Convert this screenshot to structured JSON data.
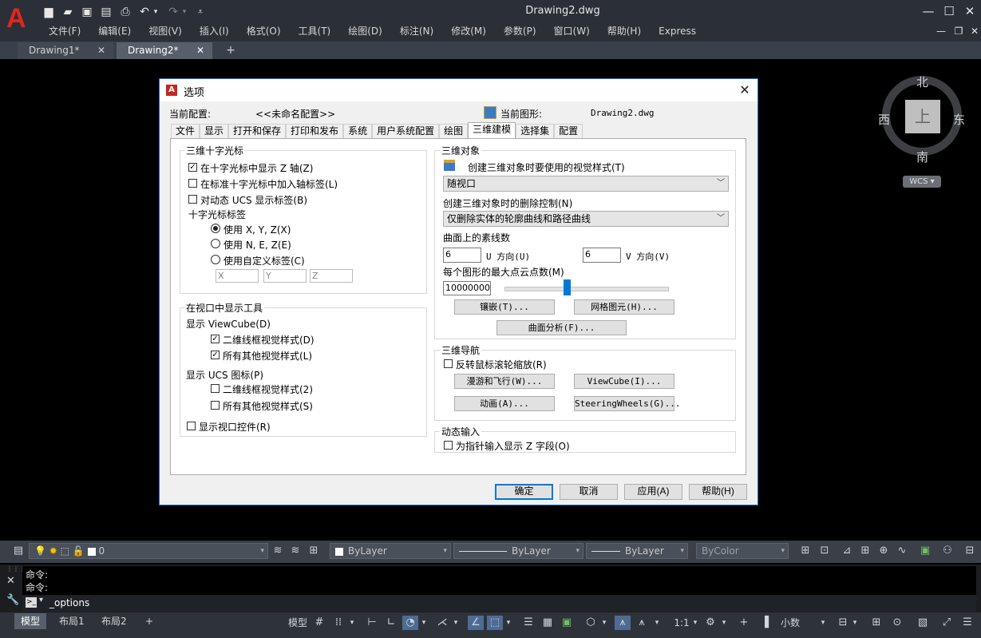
{
  "app": {
    "window_title": "Drawing2.dwg",
    "logo": "A"
  },
  "menu": [
    "文件(F)",
    "编辑(E)",
    "视图(V)",
    "插入(I)",
    "格式(O)",
    "工具(T)",
    "绘图(D)",
    "标注(N)",
    "修改(M)",
    "参数(P)",
    "窗口(W)",
    "帮助(H)",
    "Express"
  ],
  "doc_tabs": [
    {
      "label": "Drawing1*",
      "active": false
    },
    {
      "label": "Drawing2*",
      "active": true
    }
  ],
  "viewcube": {
    "face": "上",
    "north": "北",
    "south": "南",
    "east": "东",
    "west": "西",
    "wcs": "WCS"
  },
  "dialog": {
    "title": "选项",
    "current_profile_label": "当前配置:",
    "current_profile_value": "<<未命名配置>>",
    "current_drawing_label": "当前图形:",
    "current_drawing_value": "Drawing2.dwg",
    "tabs": [
      "文件",
      "显示",
      "打开和保存",
      "打印和发布",
      "系统",
      "用户系统配置",
      "绘图",
      "三维建模",
      "选择集",
      "配置"
    ],
    "selected_tab": "三维建模",
    "crosshair": {
      "title": "三维十字光标",
      "show_z": "在十字光标中显示 Z 轴(Z)",
      "axis_labels": "在标准十字光标中加入轴标签(L)",
      "dynamic_ucs": "对动态 UCS 显示标签(B)",
      "labels_title": "十字光标标签",
      "opt_xyz": "使用 X, Y, Z(X)",
      "opt_nez": "使用 N, E, Z(E)",
      "opt_custom": "使用自定义标签(C)",
      "ph_x": "X",
      "ph_y": "Y",
      "ph_z": "Z"
    },
    "viewport_tools": {
      "title": "在视口中显示工具",
      "viewcube_label": "显示 ViewCube(D)",
      "vc_2d": "二维线框视觉样式(D)",
      "vc_other": "所有其他视觉样式(L)",
      "ucs_label": "显示 UCS 图标(P)",
      "ucs_2d": "二维线框视觉样式(2)",
      "ucs_other": "所有其他视觉样式(S)",
      "viewport_controls": "显示视口控件(R)"
    },
    "objects3d": {
      "title": "三维对象",
      "visual_style_label": "创建三维对象时要使用的视觉样式(T)",
      "visual_style_value": "随视口",
      "delete_label": "创建三维对象时的删除控制(N)",
      "delete_value": "仅删除实体的轮廓曲线和路径曲线",
      "isolines_label": "曲面上的素线数",
      "u_value": "6",
      "u_label": "U 方向(U)",
      "v_value": "6",
      "v_label": "V 方向(V)",
      "pointcloud_label": "每个图形的最大点云点数(M)",
      "pointcloud_value": "10000000",
      "pointcloud_slider": 0.38,
      "btn_tessellation": "镶嵌(T)...",
      "btn_mesh": "网格图元(H)...",
      "btn_surface": "曲面分析(F)..."
    },
    "nav3d": {
      "title": "三维导航",
      "reverse_wheel": "反转鼠标滚轮缩放(R)",
      "btn_walk": "漫游和飞行(W)...",
      "btn_viewcube": "ViewCube(I)...",
      "btn_anim": "动画(A)...",
      "btn_steering": "SteeringWheels(G)..."
    },
    "dyn_input": {
      "title": "动态输入",
      "show_z": "为指针输入显示 Z 字段(O)"
    },
    "buttons": {
      "ok": "确定",
      "cancel": "取消",
      "apply": "应用(A)",
      "help": "帮助(H)"
    }
  },
  "layer_toolbar": {
    "layer_value": "0",
    "color": "ByLayer",
    "linetype": "ByLayer",
    "lineweight": "ByLayer",
    "plotstyle": "ByColor"
  },
  "command": {
    "history": [
      "命令:",
      "命令:"
    ],
    "input": "_options"
  },
  "status": {
    "tabs": [
      {
        "label": "模型",
        "active": true
      },
      {
        "label": "布局1",
        "active": false
      },
      {
        "label": "布局2",
        "active": false
      }
    ],
    "model_label": "模型",
    "scale": "1:1",
    "units": "小数"
  }
}
